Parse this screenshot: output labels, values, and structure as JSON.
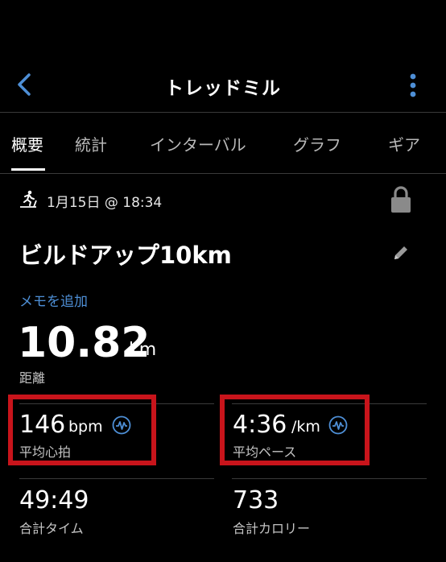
{
  "header": {
    "title": "トレッドミル",
    "back_icon": "chevron-left-icon",
    "more_icon": "more-vertical-icon",
    "accent_color": "#4e8fd6"
  },
  "tabs": [
    {
      "label": "概要",
      "active": true
    },
    {
      "label": "統計",
      "active": false
    },
    {
      "label": "インターバル",
      "active": false
    },
    {
      "label": "グラフ",
      "active": false
    },
    {
      "label": "ギア",
      "active": false
    }
  ],
  "activity": {
    "icon": "treadmill-runner-icon",
    "date": "1月15日 @ 18:34",
    "lock_icon": "lock-icon",
    "name": "ビルドアップ10km",
    "edit_icon": "pencil-icon",
    "add_note": "メモを追加"
  },
  "distance": {
    "value": "10.82",
    "unit": "km",
    "label": "距離"
  },
  "metrics": {
    "heart_rate": {
      "value": "146",
      "unit": "bpm",
      "label": "平均心拍",
      "icon": "chart-wave-icon"
    },
    "pace": {
      "value": "4:36",
      "unit": "/km",
      "label": "平均ペース",
      "icon": "chart-wave-icon"
    },
    "time": {
      "value": "49:49",
      "label": "合計タイム"
    },
    "calories": {
      "value": "733",
      "label": "合計カロリー"
    }
  },
  "highlight_color": "#c8141b"
}
